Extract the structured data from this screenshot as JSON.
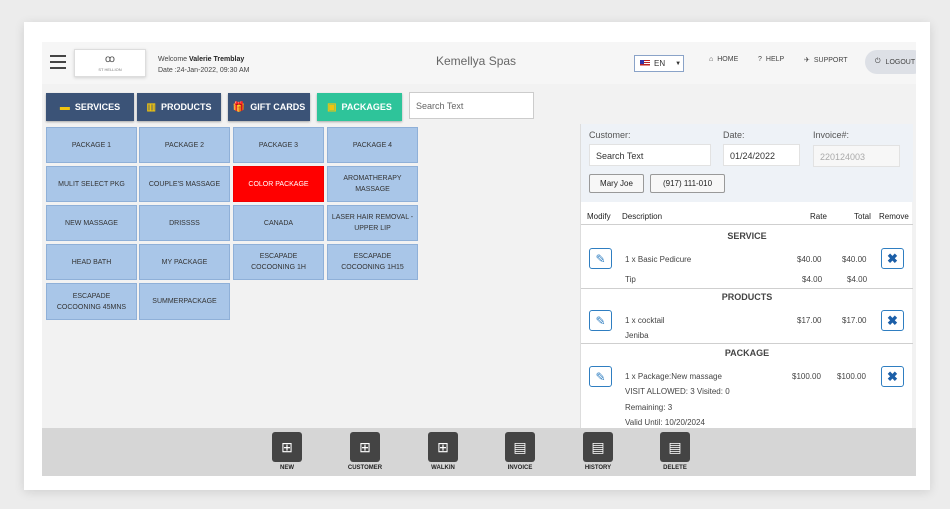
{
  "header": {
    "logo_mark": "ꝏ",
    "logo_text": "ST HELLION",
    "welcome_prefix": "Welcome",
    "user_name": "Valerie Tremblay",
    "date_line": "Date :24-Jan-2022, 09:30 AM",
    "app_title": "Kemellya Spas",
    "language": "EN",
    "nav": [
      {
        "icon": "home-icon",
        "glyph": "⌂",
        "label": "HOME"
      },
      {
        "icon": "help-icon",
        "glyph": "?",
        "label": "HELP"
      },
      {
        "icon": "support-icon",
        "glyph": "✈",
        "label": "SUPPORT"
      }
    ],
    "logout_label": "LOGOUT"
  },
  "tabs": [
    {
      "label": "SERVICES",
      "glyph": "▬",
      "icon": "bed-icon",
      "active": false
    },
    {
      "label": "PRODUCTS",
      "glyph": "▥",
      "icon": "barcode-icon",
      "active": false
    },
    {
      "label": "GIFT CARDS",
      "glyph": "🎁",
      "icon": "gift-icon",
      "active": false
    },
    {
      "label": "PACKAGES",
      "glyph": "▣",
      "icon": "money-icon",
      "active": true
    }
  ],
  "search_placeholder": "Search Text",
  "packages": [
    "PACKAGE 1",
    "PACKAGE 2",
    "PACKAGE 3",
    "PACKAGE 4",
    "MULIT SELECT PKG",
    "COUPLE'S MASSAGE",
    "COLOR PACKAGE",
    "AROMATHERAPY MASSAGE",
    "NEW MASSAGE",
    "DRISSSS",
    "CANADA",
    "LASER HAIR REMOVAL - UPPER LIP",
    "HEAD BATH",
    "MY PACKAGE",
    "ESCAPADE COCOONING 1H",
    "ESCAPADE COCOONING 1H15",
    "ESCAPADE COCOONING 45MNS",
    "SUMMERPACKAGE"
  ],
  "customer": {
    "customer_label": "Customer:",
    "date_label": "Date:",
    "invoice_label": "Invoice#:",
    "customer_value": "Search Text",
    "date_value": "01/24/2022",
    "invoice_value": "220124003",
    "name_chip": "Mary Joe",
    "phone_chip": "(917) 111-010"
  },
  "table_headers": {
    "modify": "Modify",
    "description": "Description",
    "rate": "Rate",
    "total": "Total",
    "remove": "Remove"
  },
  "sections": {
    "service": {
      "title": "SERVICE",
      "item": "1 x Basic Pedicure",
      "rate": "$40.00",
      "total": "$40.00",
      "tip_label": "Tip",
      "tip_rate": "$4.00",
      "tip_total": "$4.00"
    },
    "products": {
      "title": "PRODUCTS",
      "item": "1 x cocktail",
      "sub": "Jeniba",
      "rate": "$17.00",
      "total": "$17.00"
    },
    "package": {
      "title": "PACKAGE",
      "item": "1 x Package:New massage",
      "visits": "VISIT ALLOWED: 3 Visited: 0",
      "remaining": "Remaining: 3",
      "valid": "Valid Until: 10/20/2024",
      "rate": "$100.00",
      "total": "$100.00"
    }
  },
  "toolbar": [
    {
      "label": "NEW",
      "icon": "new-icon",
      "glyph": "⊞"
    },
    {
      "label": "CUSTOMER",
      "icon": "customer-icon",
      "glyph": "⊞"
    },
    {
      "label": "WALKIN",
      "icon": "walkin-icon",
      "glyph": "⊞"
    },
    {
      "label": "INVOICE",
      "icon": "invoice-icon",
      "glyph": "▤"
    },
    {
      "label": "HISTORY",
      "icon": "history-icon",
      "glyph": "▤"
    },
    {
      "label": "DELETE",
      "icon": "delete-icon",
      "glyph": "▤"
    }
  ],
  "colors": {
    "tab_dark": "#3b5377",
    "tab_active": "#2ec49a",
    "package_tile": "#a9c6e8",
    "package_highlight": "#ff0000"
  }
}
